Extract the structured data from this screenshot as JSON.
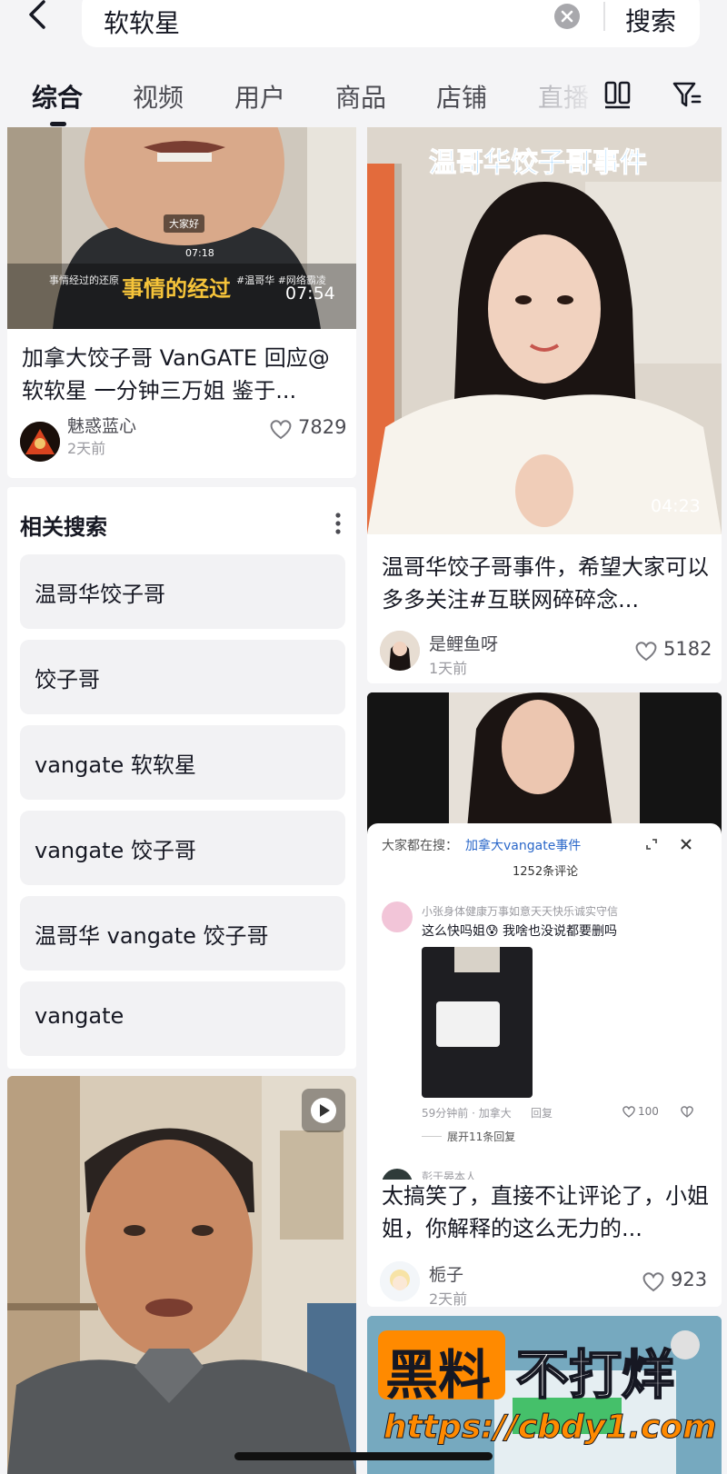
{
  "search": {
    "query": "软软星",
    "button_label": "搜索"
  },
  "tabs": [
    {
      "label": "综合"
    },
    {
      "label": "视频"
    },
    {
      "label": "用户"
    },
    {
      "label": "商品"
    },
    {
      "label": "店铺"
    },
    {
      "label": "直播"
    }
  ],
  "card1": {
    "overlay_small_label": "大家好",
    "overlay_time_small": "07:18",
    "overlay_caption": "事情经过的还原",
    "overlay_tags": "#温哥华 #网络霸凌",
    "overlay_big_caption": "事情的经过",
    "duration": "07:54",
    "title": "加拿大饺子哥 VanGATE 回应@软软星 一分钟三万姐 鉴于...",
    "author": "魅惑蓝心",
    "time": "2天前",
    "likes": "7829"
  },
  "card2": {
    "overlay_title": "温哥华饺子哥事件",
    "duration": "04:23",
    "title": "温哥华饺子哥事件，希望大家可以多多关注#互联网碎碎念...",
    "author": "是鲤鱼呀",
    "time": "1天前",
    "likes": "5182"
  },
  "related": {
    "title": "相关搜索",
    "items": [
      {
        "label": "温哥华饺子哥"
      },
      {
        "label": "饺子哥"
      },
      {
        "label": "vangate 软软星"
      },
      {
        "label": "vangate 饺子哥"
      },
      {
        "label": "温哥华 vangate 饺子哥"
      },
      {
        "label": "vangate"
      }
    ]
  },
  "card3": {
    "search_prefix": "大家都在搜：",
    "search_link": "加拿大vangate事件",
    "comment_count": "1252条评论",
    "commenter": "小张身体健康万事如意天天快乐诚实守信",
    "comment_text": "这么快吗姐😰 我啥也没说都要删吗",
    "comment_meta_time": "59分钟前 · 加拿大",
    "comment_reply": "回复",
    "comment_likes": "100",
    "expand_replies": "展开11条回复",
    "reply_author": "彭于晏本人",
    "title": "太搞笑了，直接不让评论了，小姐姐，你解释的这么无力的...",
    "author": "栀子",
    "time": "2天前",
    "likes": "923"
  },
  "watermark": {
    "brand_a": "黑料",
    "brand_b": "不打烊",
    "url": "https://cbdy1.com"
  },
  "colors": {
    "bg": "#f4f4f6",
    "accent_blue": "#3da8ff",
    "watermark_orange": "#ff8a00"
  }
}
